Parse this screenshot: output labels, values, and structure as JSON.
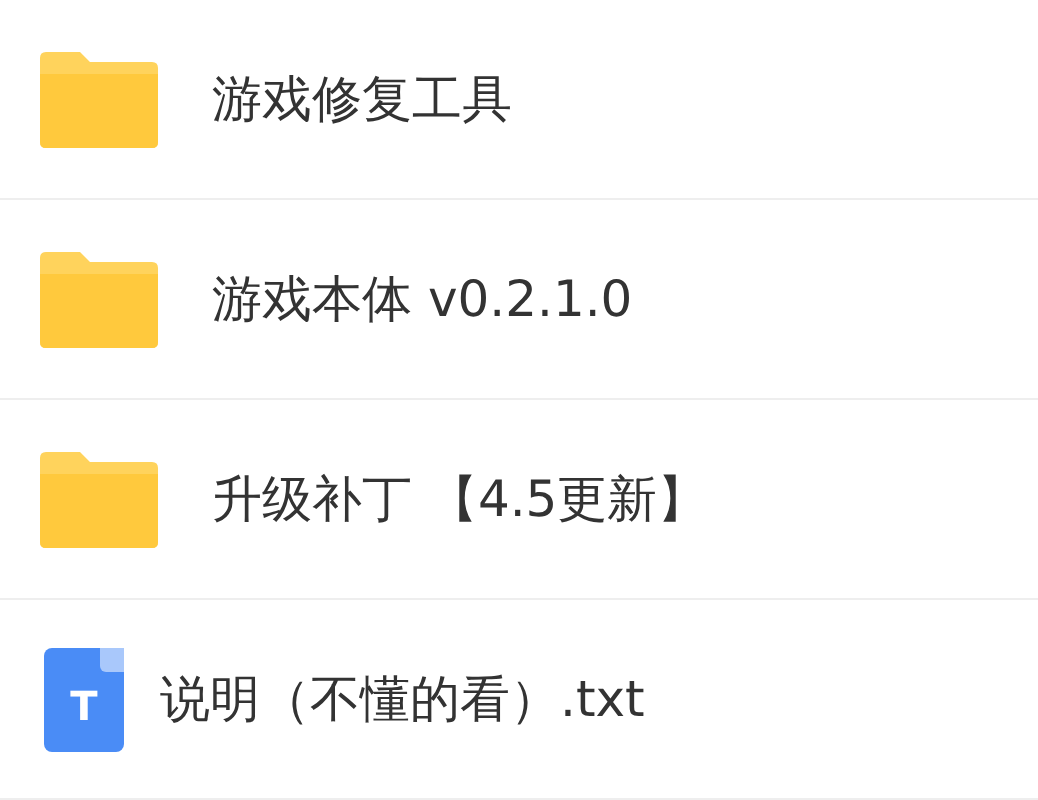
{
  "files": [
    {
      "kind": "folder",
      "name": "游戏修复工具"
    },
    {
      "kind": "folder",
      "name": "游戏本体 v0.2.1.0"
    },
    {
      "kind": "folder",
      "name": "升级补丁 【4.5更新】"
    },
    {
      "kind": "text",
      "name": "说明（不懂的看）.txt",
      "icon_letter": "T"
    }
  ]
}
